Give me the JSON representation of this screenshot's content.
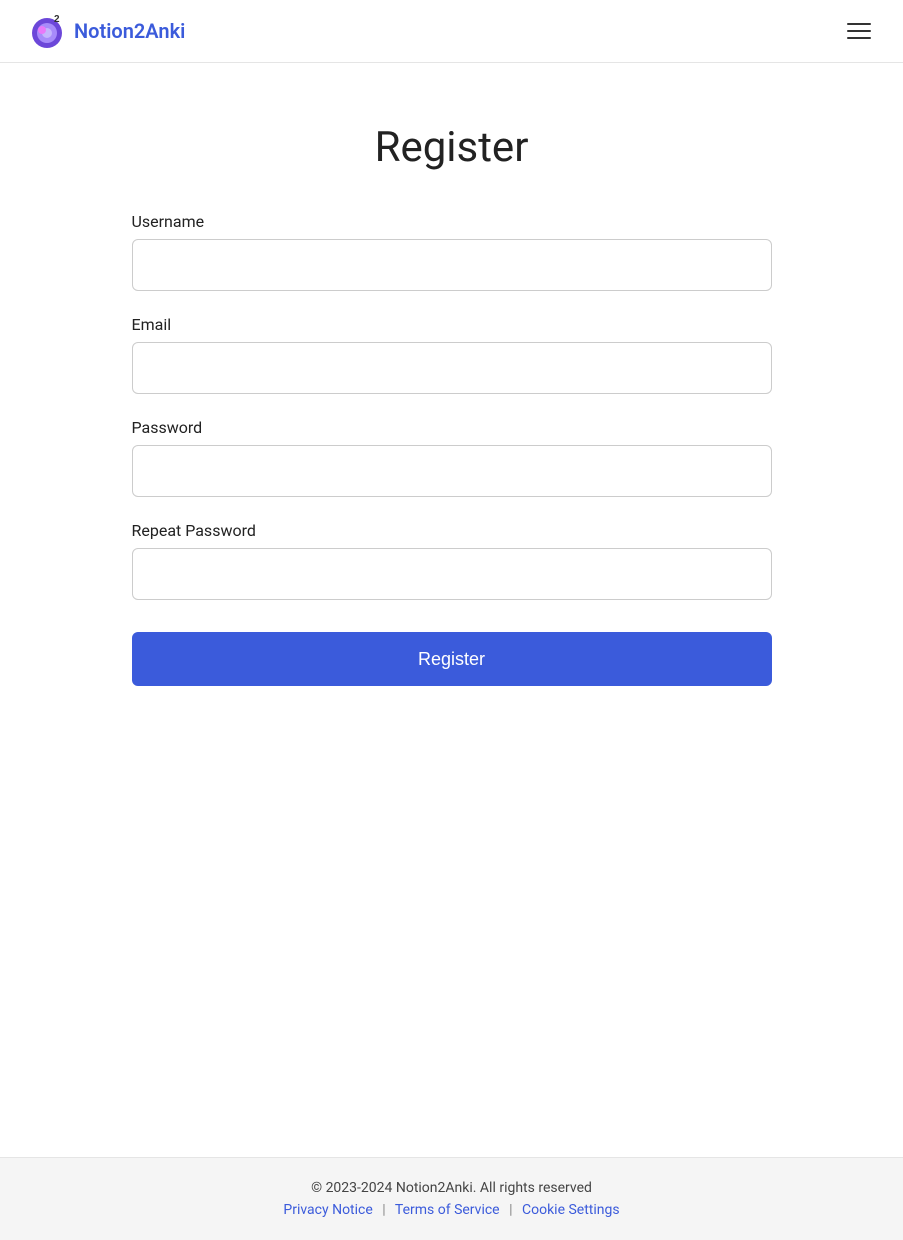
{
  "header": {
    "logo_text": "Notion2Anki",
    "menu_icon_label": "menu"
  },
  "page": {
    "title": "Register"
  },
  "form": {
    "username_label": "Username",
    "username_placeholder": "",
    "email_label": "Email",
    "email_placeholder": "",
    "password_label": "Password",
    "password_placeholder": "",
    "repeat_password_label": "Repeat Password",
    "repeat_password_placeholder": "",
    "register_button": "Register"
  },
  "footer": {
    "copyright": "© 2023-2024 Notion2Anki. All rights reserved",
    "privacy_notice": "Privacy Notice",
    "terms_of_service": "Terms of Service",
    "cookie_settings": "Cookie Settings"
  }
}
